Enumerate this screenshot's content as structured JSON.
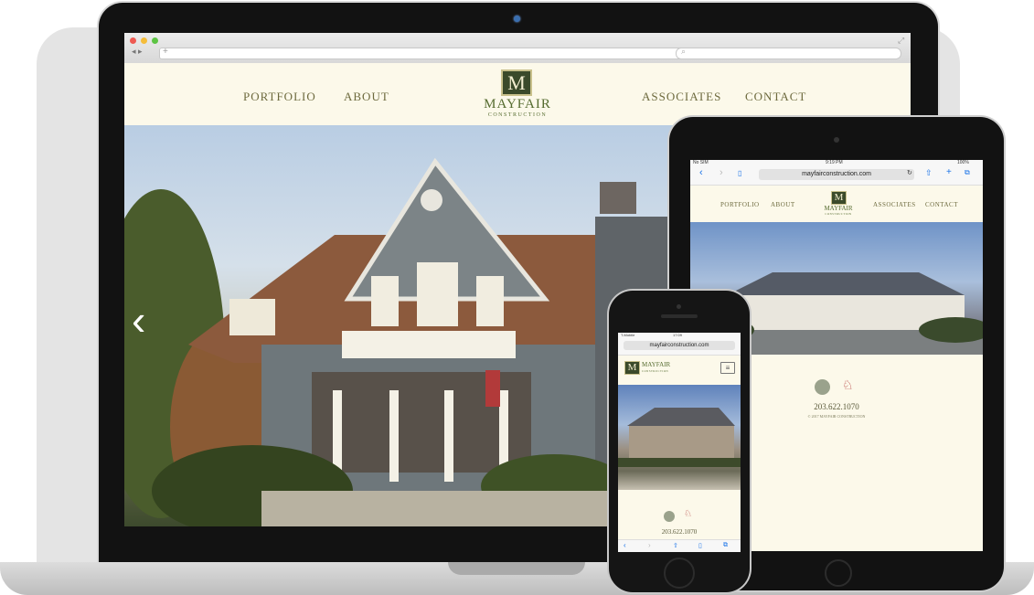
{
  "laptop": {
    "nav_left": [
      "PORTFOLIO",
      "ABOUT"
    ],
    "nav_right": [
      "ASSOCIATES",
      "CONTACT"
    ],
    "logo_letter": "M",
    "logo_name": "MAYFAIR",
    "logo_sub": "CONSTRUCTION",
    "carousel_prev": "‹"
  },
  "tablet": {
    "status_left": "No SIM",
    "status_time": "9:19 PM",
    "status_battery": "100%",
    "url": "mayfairconstruction.com",
    "nav_left": [
      "PORTFOLIO",
      "ABOUT"
    ],
    "nav_right": [
      "ASSOCIATES",
      "CONTACT"
    ],
    "logo_letter": "M",
    "logo_name": "MAYFAIR",
    "logo_sub": "CONSTRUCTION",
    "phone": "203.622.1070",
    "copyright": "© 2017 MAYFAIR CONSTRUCTION"
  },
  "phone": {
    "status_left": "T-Mobile",
    "status_time": "17:09",
    "url": "mayfairconstruction.com",
    "logo_letter": "M",
    "logo_name": "MAYFAIR",
    "logo_sub": "CONSTRUCTION",
    "phone": "203.622.1070"
  },
  "colors": {
    "brand_green": "#3b4a2a",
    "cream": "#fcf9ea",
    "nav_text": "#6d6a3e"
  }
}
